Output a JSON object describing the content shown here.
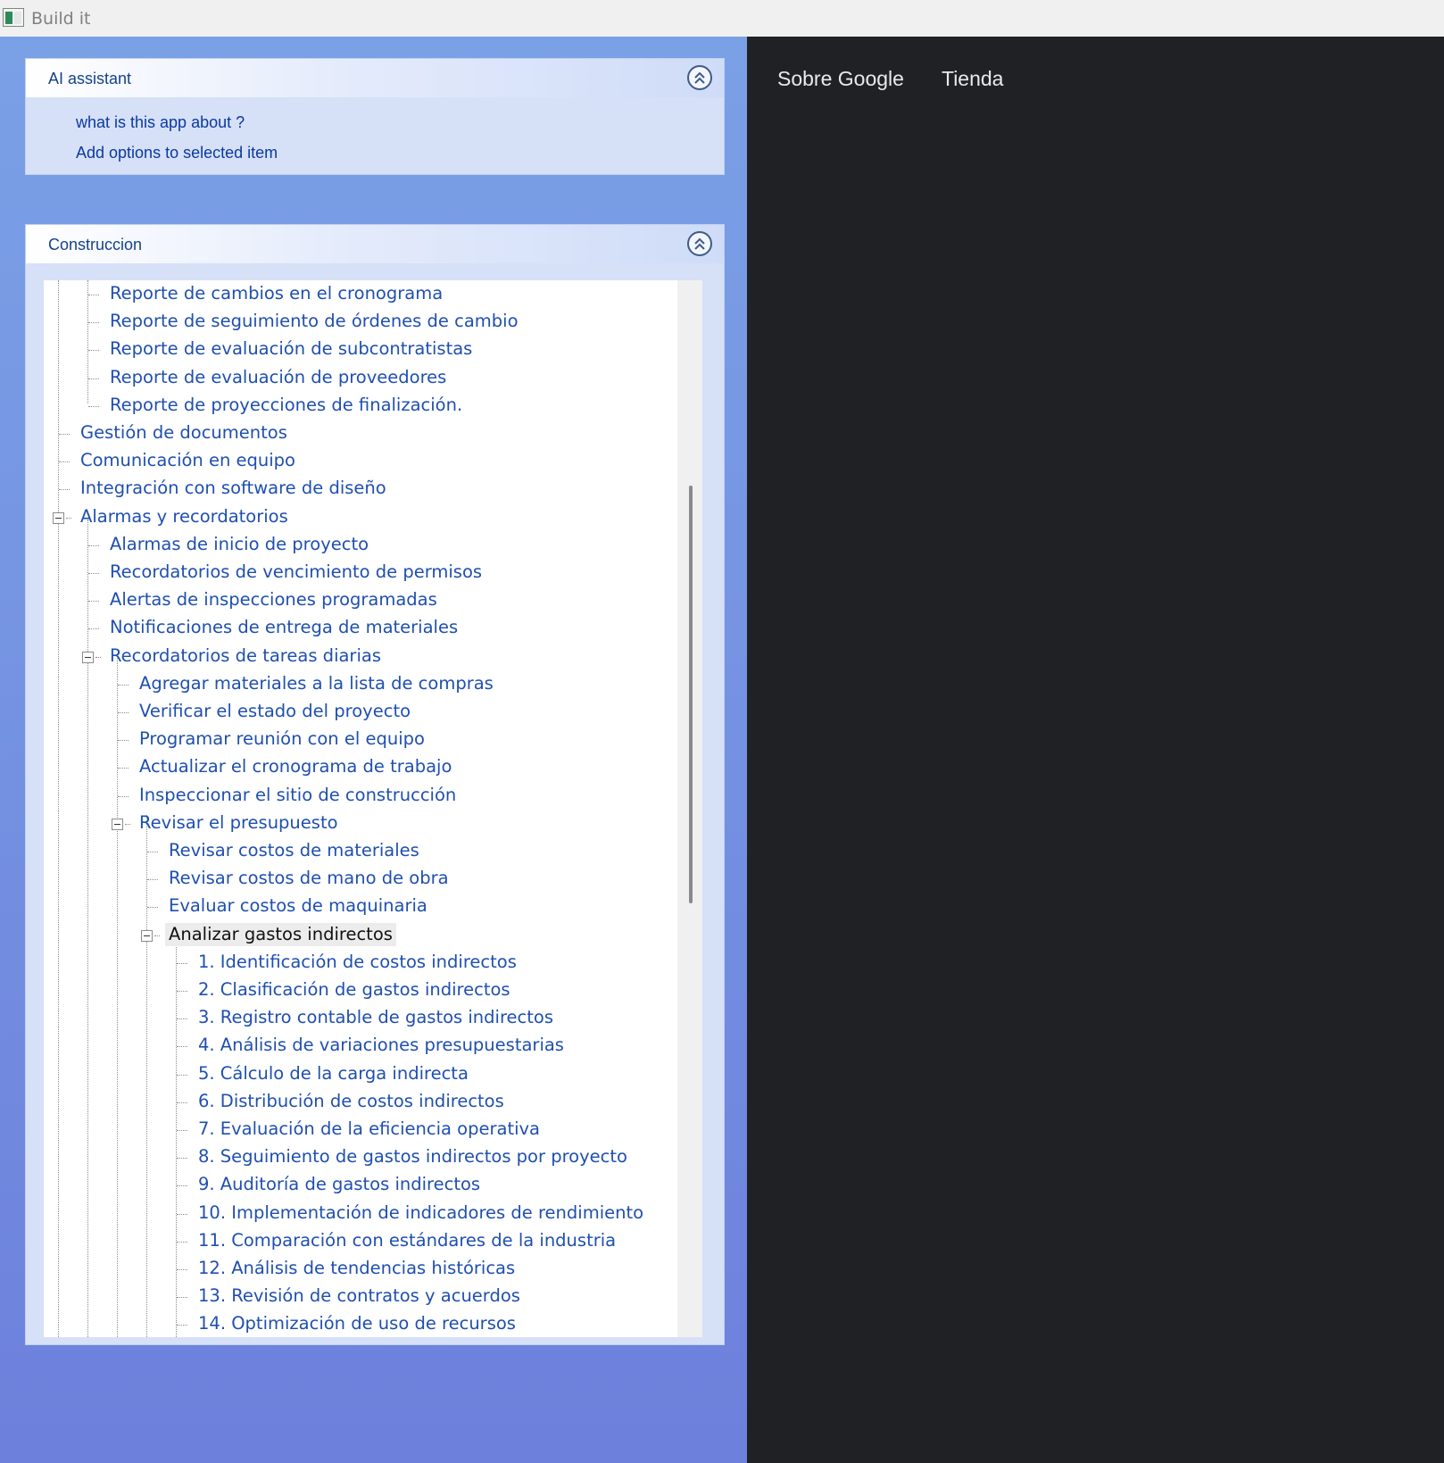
{
  "window": {
    "title": "Build it"
  },
  "ai_assistant": {
    "title": "AI assistant",
    "links": [
      "what is this app about ?",
      "Add options to selected item"
    ]
  },
  "construccion": {
    "title": "Construccion",
    "tree": [
      "Reporte de cambios en el cronograma",
      "Reporte de seguimiento de órdenes de cambio",
      "Reporte de evaluación de subcontratistas",
      "Reporte de evaluación de proveedores",
      "Reporte de proyecciones de finalización.",
      "Gestión de documentos",
      "Comunicación en equipo",
      "Integración con software de diseño",
      "Alarmas y recordatorios",
      "Alarmas de inicio de proyecto",
      "Recordatorios de vencimiento de permisos",
      "Alertas de inspecciones programadas",
      "Notificaciones de entrega de materiales",
      "Recordatorios de tareas diarias",
      "Agregar materiales a la lista de compras",
      "Verificar el estado del proyecto",
      "Programar reunión con el equipo",
      "Actualizar el cronograma de trabajo",
      "Inspeccionar el sitio de construcción",
      "Revisar el presupuesto",
      "Revisar costos de materiales",
      "Revisar costos de mano de obra",
      "Evaluar costos de maquinaria",
      "Analizar gastos indirectos",
      "1. Identificación de costos indirectos",
      "2. Clasificación de gastos indirectos",
      "3. Registro contable de gastos indirectos",
      "4. Análisis de variaciones presupuestarias",
      "5. Cálculo de la carga indirecta",
      "6. Distribución de costos indirectos",
      "7. Evaluación de la eficiencia operativa",
      "8. Seguimiento de gastos indirectos por proyecto",
      "9. Auditoría de gastos indirectos",
      "10. Implementación de indicadores de rendimiento",
      "11. Comparación con estándares de la industria",
      "12. Análisis de tendencias históricas",
      "13. Revisión de contratos y acuerdos",
      "14. Optimización de uso de recursos"
    ]
  },
  "browser": {
    "links": [
      "Sobre Google",
      "Tienda"
    ]
  }
}
